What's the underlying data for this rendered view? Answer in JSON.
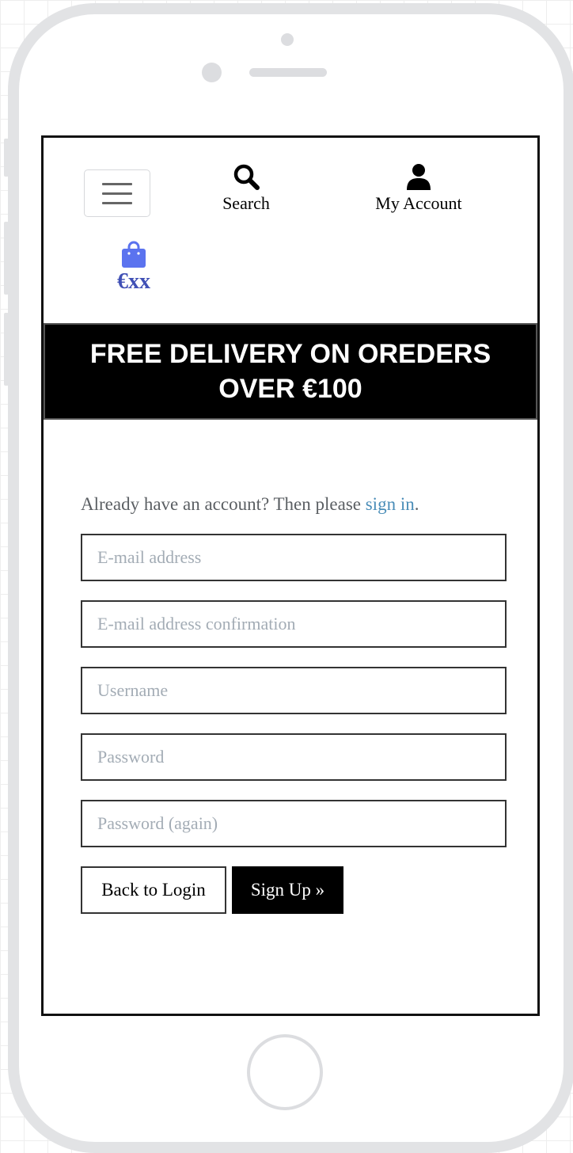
{
  "header": {
    "menu_icon": "hamburger-icon",
    "search": {
      "icon": "search-icon",
      "label": "Search"
    },
    "account": {
      "icon": "user-icon",
      "label": "My Account"
    },
    "bag": {
      "icon": "shopping-bag-icon",
      "total": "€xx",
      "color": "#4050b5",
      "icon_color": "#5b73ef"
    }
  },
  "banner": {
    "text": "FREE DELIVERY ON OREDERS OVER €100"
  },
  "signup": {
    "prompt": "Already have an account? Then please ",
    "signin_link": "sign in",
    "prompt_end": ".",
    "fields": {
      "email": {
        "placeholder": "E-mail address",
        "value": ""
      },
      "email_confirm": {
        "placeholder": "E-mail address confirmation",
        "value": ""
      },
      "username": {
        "placeholder": "Username",
        "value": ""
      },
      "password": {
        "placeholder": "Password",
        "value": ""
      },
      "password_again": {
        "placeholder": "Password (again)",
        "value": ""
      }
    },
    "back_button": "Back to Login",
    "submit_button": "Sign Up »"
  },
  "colors": {
    "link": "#4a8db8",
    "banner_bg": "#000000",
    "placeholder": "#a3acb5"
  }
}
